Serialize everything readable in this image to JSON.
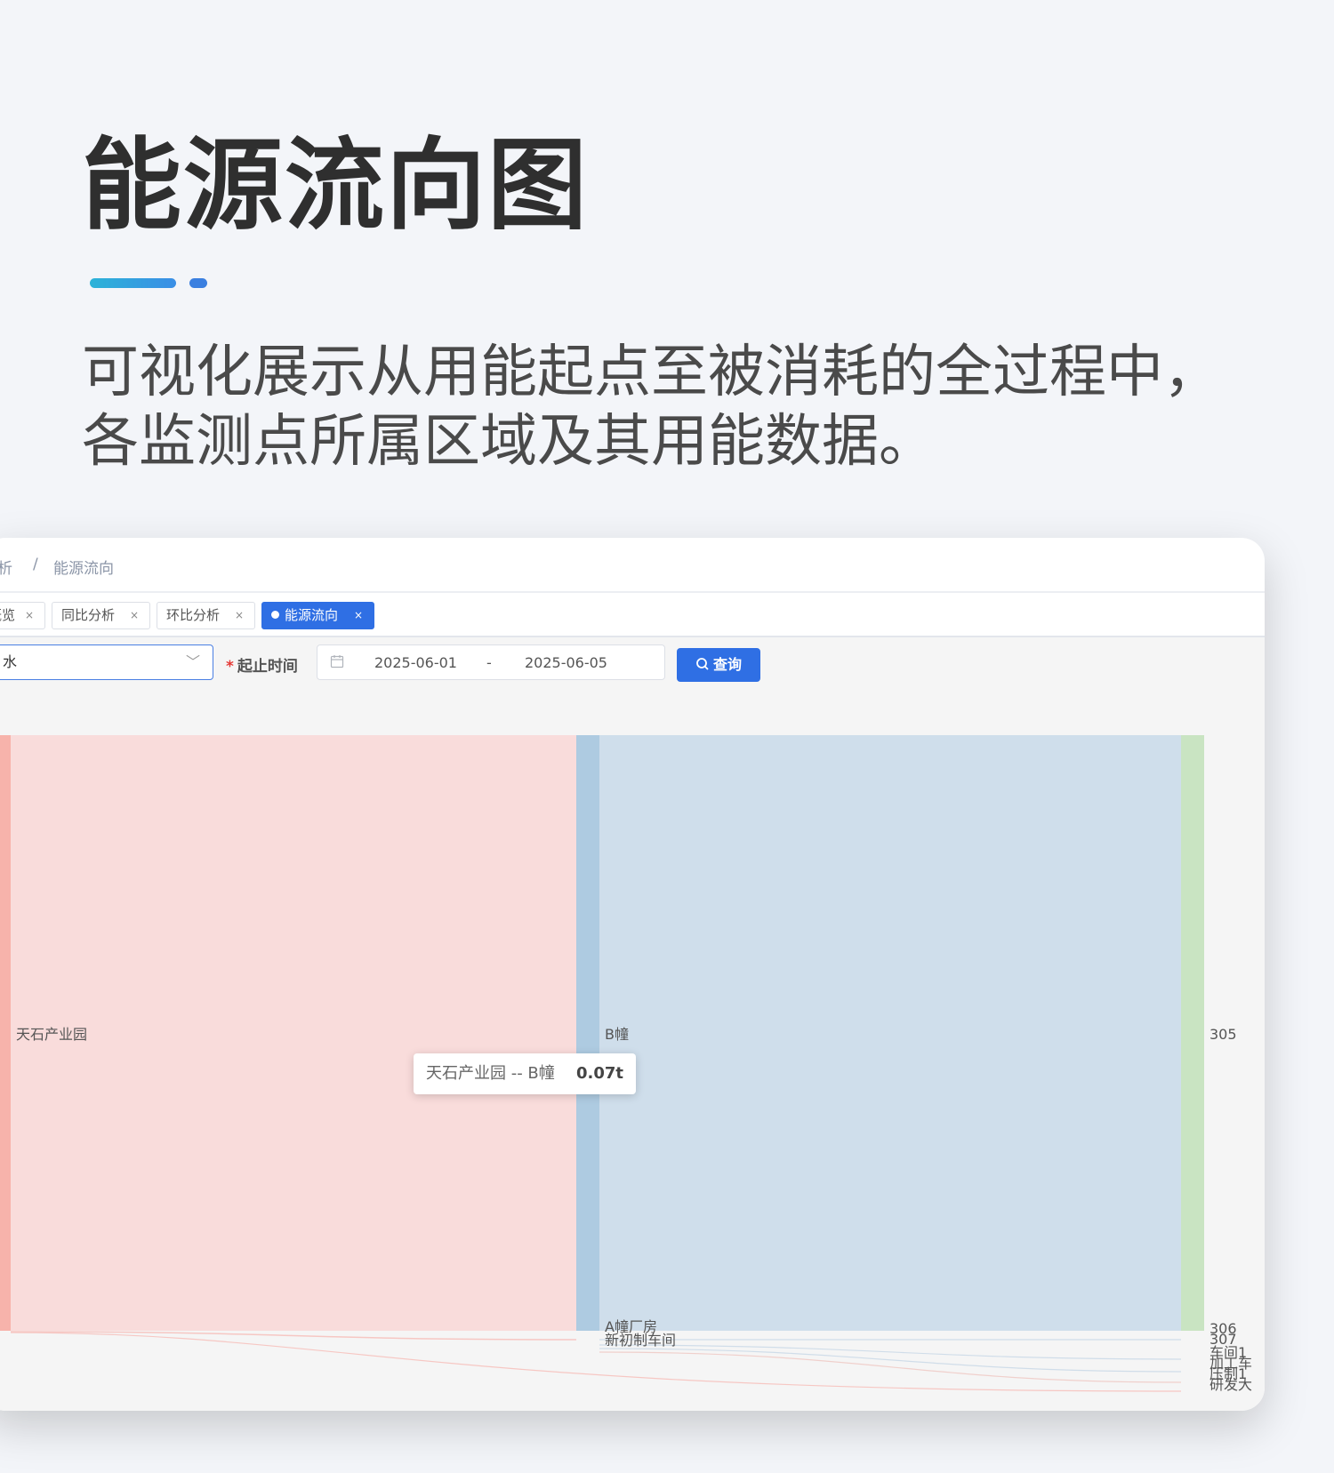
{
  "hero": {
    "title": "能源流向图",
    "subtitle_line1": "可视化展示从用能起点至被消耗的全过程中，",
    "subtitle_line2": "各监测点所属区域及其用能数据。",
    "accent_color": "#2f6fe4"
  },
  "breadcrumb": {
    "parent": "分析",
    "separator": "/",
    "current": "能源流向"
  },
  "tabs": [
    {
      "label": "概览",
      "close": "×",
      "active": false
    },
    {
      "label": "同比分析",
      "close": "×",
      "active": false
    },
    {
      "label": "环比分析",
      "close": "×",
      "active": false
    },
    {
      "label": "能源流向",
      "close": "×",
      "active": true
    }
  ],
  "filters": {
    "energy_type_value": "水",
    "chevron": "﹀",
    "time_label": "起止时间",
    "required_mark": "*",
    "start_date": "2025-06-01",
    "range_separator": "-",
    "end_date": "2025-06-05",
    "query_button": "查询",
    "search_icon": "search-icon"
  },
  "sankey": {
    "nodes": {
      "root": "天石产业园",
      "b_building": "B幢",
      "a_building": "A幢厂房",
      "workshop": "新初制车间",
      "room_305": "305",
      "room_306": "306",
      "room_307": "307",
      "room_c1": "车间1",
      "room_c2": "加工车",
      "room_c3": "压制1",
      "room_c4": "研发大"
    },
    "colors": {
      "root_node": "#f7b3ab",
      "root_flow": "#f9dcdb",
      "b_node": "#aecbe1",
      "b_flow": "#cfdeeb",
      "leaf_node": "#c9e4c2"
    }
  },
  "tooltip": {
    "name": "天石产业园 -- B幢",
    "value": "0.07t"
  }
}
